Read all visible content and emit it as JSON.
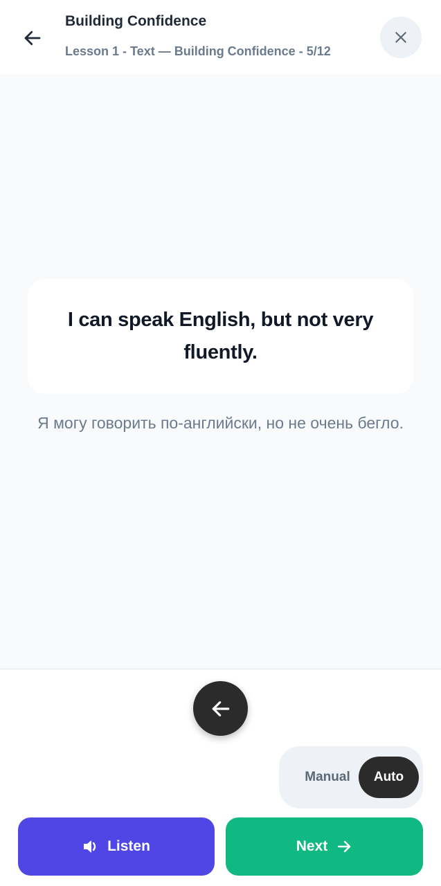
{
  "header": {
    "title": "Building Confidence",
    "subtitle": "Lesson 1 - Text — Building Confidence - 5/12",
    "back_icon": "arrow-left-icon",
    "close_icon": "close-icon"
  },
  "lesson": {
    "phrase": "I can speak English, but not very fluently.",
    "translation": "Я могу говорить по-английски, но не очень бегло."
  },
  "controls": {
    "previous_icon": "arrow-left-icon",
    "mode": {
      "manual_label": "Manual",
      "auto_label": "Auto",
      "selected": "Auto"
    },
    "listen_label": "Listen",
    "listen_icon": "speaker-icon",
    "next_label": "Next",
    "next_icon": "arrow-right-icon"
  },
  "colors": {
    "listen": "#4f46e5",
    "next": "#10b981",
    "dark": "#2b2b2b"
  }
}
